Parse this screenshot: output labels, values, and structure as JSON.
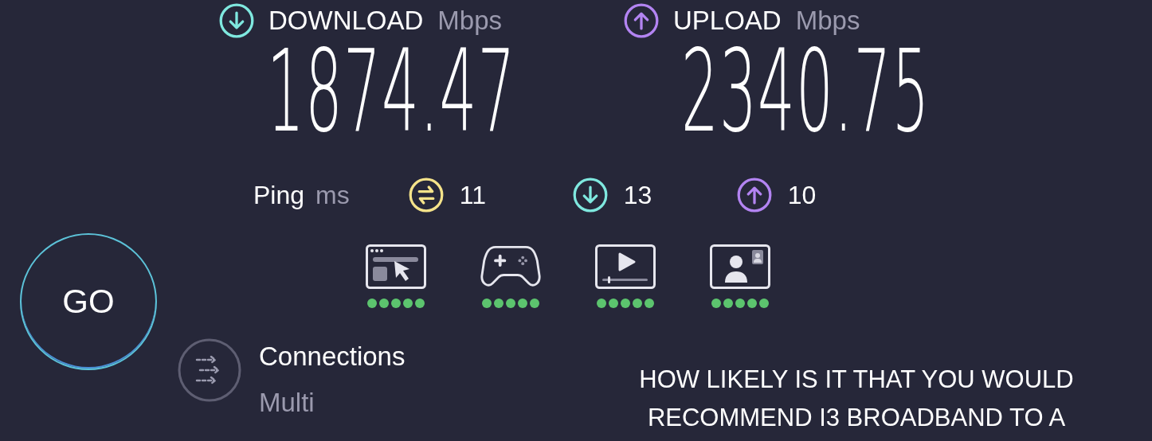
{
  "speeds": [
    {
      "kind": "download",
      "label": "DOWNLOAD",
      "unit": "Mbps",
      "value": "1874.47"
    },
    {
      "kind": "upload",
      "label": "UPLOAD",
      "unit": "Mbps",
      "value": "2340.75"
    }
  ],
  "ping": {
    "label": "Ping",
    "unit": "ms",
    "values": [
      {
        "kind": "idle",
        "value": "11"
      },
      {
        "kind": "download",
        "value": "13"
      },
      {
        "kind": "upload",
        "value": "10"
      }
    ]
  },
  "go_button": "GO",
  "activities": [
    {
      "kind": "browsing",
      "stars": 5
    },
    {
      "kind": "gaming",
      "stars": 5
    },
    {
      "kind": "streaming",
      "stars": 5
    },
    {
      "kind": "video-call",
      "stars": 5
    }
  ],
  "connections": {
    "label": "Connections",
    "value": "Multi"
  },
  "survey": {
    "question": "HOW LIKELY IS IT THAT YOU WOULD\nRECOMMEND I3 BROADBAND TO A"
  }
}
